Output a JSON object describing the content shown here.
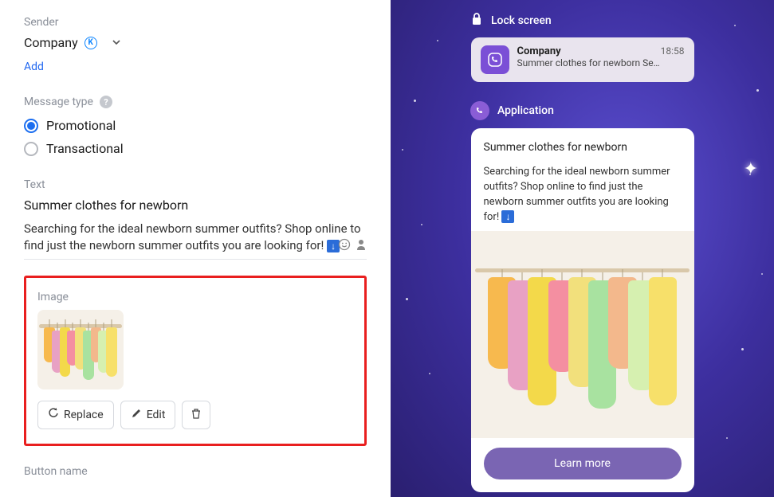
{
  "sender": {
    "label": "Sender",
    "value": "Company",
    "add_link": "Add"
  },
  "message_type": {
    "label": "Message type",
    "options": [
      {
        "label": "Promotional",
        "checked": true
      },
      {
        "label": "Transactional",
        "checked": false
      }
    ]
  },
  "text": {
    "label": "Text",
    "title_value": "Summer clothes for newborn",
    "body_value": "Searching for the ideal newborn summer outfits? Shop online to find just the newborn summer outfits you are looking for!"
  },
  "image": {
    "label": "Image",
    "buttons": {
      "replace": "Replace",
      "edit": "Edit"
    }
  },
  "button_name": {
    "label": "Button name"
  },
  "lockscreen": {
    "header": "Lock screen",
    "notif_title": "Company",
    "notif_time": "18:58",
    "notif_text": "Summer clothes for newborn Se…"
  },
  "application": {
    "header": "Application",
    "title": "Summer clothes for newborn",
    "body": "Searching for the ideal newborn summer outfits? Shop online to find just the newborn summer outfits you are looking for!",
    "cta": "Learn more"
  },
  "dress_colors": [
    "#f7b94e",
    "#e8a1c4",
    "#f3d94a",
    "#f48fa1",
    "#f2e07c",
    "#a8e2a0",
    "#f3b88c",
    "#d6f0b0",
    "#f7e06a"
  ]
}
